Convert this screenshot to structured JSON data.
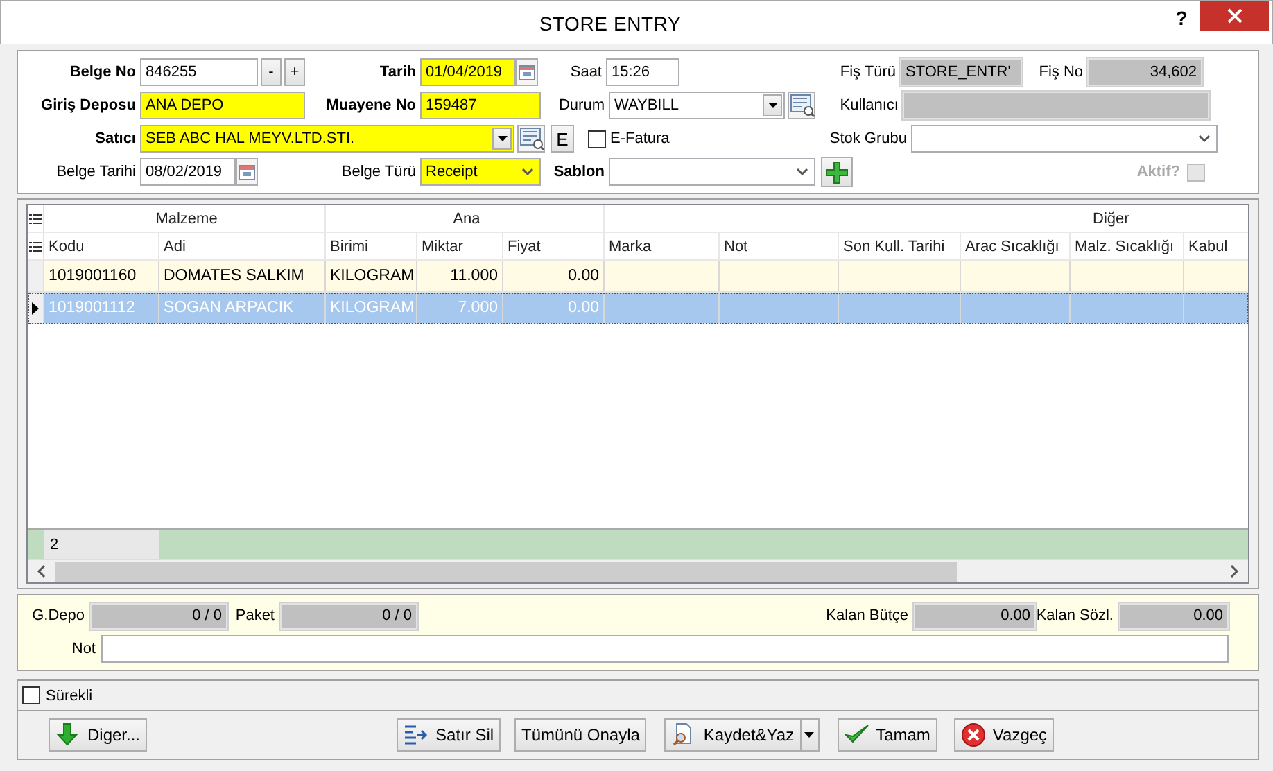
{
  "window": {
    "title": "STORE ENTRY",
    "help": "?"
  },
  "header": {
    "fields": [
      {
        "label": "Belge No",
        "value": "846255",
        "kind": "stepper",
        "steps": [
          "-",
          "+"
        ],
        "required": true,
        "highlighted": false
      },
      {
        "label": "Tarih",
        "value": "01/04/2019",
        "kind": "date",
        "required": true,
        "highlighted": true
      },
      {
        "label": "Saat",
        "value": "15:26",
        "kind": "text",
        "required": false,
        "highlighted": false
      },
      {
        "label": "Fiş Türü",
        "value": "STORE_ENTR'",
        "kind": "text",
        "required": false,
        "highlighted": false,
        "readonly": true
      },
      {
        "label": "Fiş No",
        "value": "34,602",
        "kind": "number",
        "required": false,
        "highlighted": false,
        "readonly": true
      },
      {
        "label": "Giriş Deposu",
        "value": "ANA DEPO",
        "kind": "text",
        "required": true,
        "highlighted": true
      },
      {
        "label": "Muayene No",
        "value": "159487",
        "kind": "text",
        "required": true,
        "highlighted": true
      },
      {
        "label": "Durum",
        "value": "WAYBILL",
        "kind": "lookup",
        "required": false,
        "highlighted": false
      },
      {
        "label": "Kullanıcı",
        "kind": "text",
        "required": false,
        "highlighted": false,
        "readonly": true
      },
      {
        "label": "Satıcı",
        "value": "SEB ABC HAL MEYV.LTD.STI.",
        "kind": "lookup",
        "required": true,
        "highlighted": true
      },
      {
        "kind": "button",
        "text": "E"
      },
      {
        "label": "E-Fatura",
        "kind": "checkbox",
        "checked": false
      },
      {
        "label": "Stok Grubu",
        "kind": "select",
        "required": false,
        "highlighted": false
      },
      {
        "label": "Belge Tarihi",
        "value": "08/02/2019",
        "kind": "date",
        "required": false,
        "highlighted": false
      },
      {
        "label": "Belge Türü",
        "value": "Receipt",
        "kind": "select",
        "required": false,
        "highlighted": true
      },
      {
        "label": "Sablon",
        "kind": "select",
        "required": true,
        "highlighted": false
      },
      {
        "kind": "add"
      },
      {
        "label": "Aktif?",
        "kind": "flag",
        "checked": false,
        "disabled": true
      }
    ]
  },
  "grid": {
    "groups": [
      "Malzeme",
      "Ana",
      "Diğer"
    ],
    "columns": [
      "Kodu",
      "Adi",
      "Birimi",
      "Miktar",
      "Fiyat",
      "Marka",
      "Not",
      "Son Kull. Tarihi",
      "Arac Sıcaklığı",
      "Malz. Sıcaklığı",
      "Kabul"
    ],
    "rows": [
      {
        "cells": [
          "1019001160",
          "DOMATES SALKIM",
          "KILOGRAM",
          "11.000",
          "0.00"
        ],
        "selected": false
      },
      {
        "cells": [
          "1019001112",
          "SOGAN ARPACIK",
          "KILOGRAM",
          "7.000",
          "0.00"
        ],
        "selected": true
      }
    ],
    "count": "2"
  },
  "summary": {
    "fields": [
      {
        "label": "G.Depo",
        "value": "0 / 0"
      },
      {
        "label": "Paket",
        "value": "0 / 0"
      },
      {
        "label": "Kalan Bütçe",
        "value": "0.00"
      },
      {
        "label": "Kalan Sözl.",
        "value": "0.00"
      }
    ],
    "note": {
      "label": "Not"
    }
  },
  "continuous": {
    "label": "Sürekli",
    "checked": false
  },
  "buttons": [
    {
      "label": "Diger...",
      "kind": "down"
    },
    {
      "label": "Satır Sil",
      "kind": "delete-row"
    },
    {
      "label": "Tümünü Onayla",
      "kind": "plain"
    },
    {
      "label": "Kaydet&Yaz",
      "kind": "print",
      "menu": true
    },
    {
      "label": "Tamam",
      "kind": "ok"
    },
    {
      "label": "Vazgeç",
      "kind": "cancel"
    }
  ]
}
